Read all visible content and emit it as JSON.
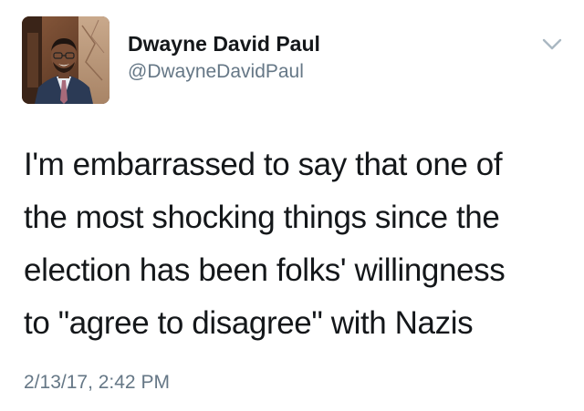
{
  "author": {
    "display_name": "Dwayne David Paul",
    "handle": "@DwayneDavidPaul"
  },
  "tweet": {
    "text_lines": [
      "I'm embarrassed to say that one of",
      "the most shocking things since the",
      "election has been folks' willingness",
      "to \"agree to disagree\" with Nazis"
    ],
    "timestamp": "2/13/17, 2:42 PM"
  },
  "icons": {
    "menu": "chevron-down-icon"
  },
  "colors": {
    "primary_text": "#14171a",
    "secondary_text": "#657786",
    "chevron": "#aab8c2"
  }
}
